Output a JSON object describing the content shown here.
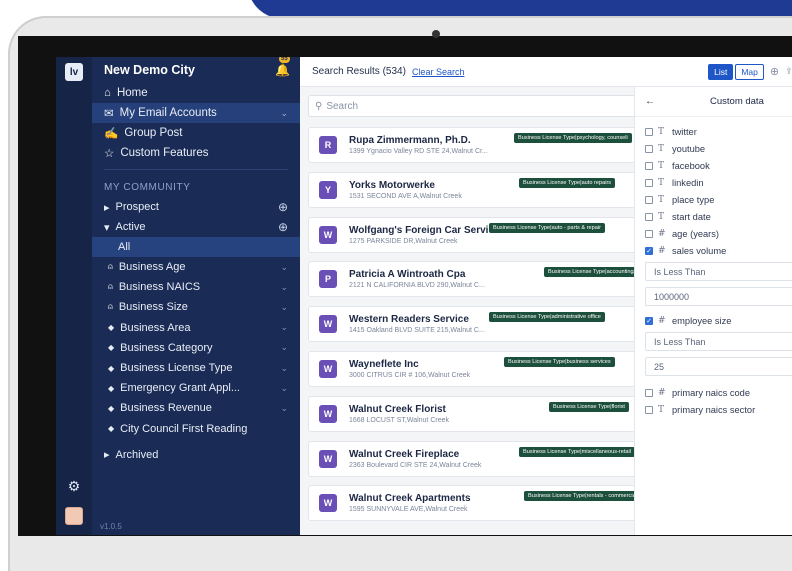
{
  "rail": {
    "logo": "lv"
  },
  "sidebar": {
    "title": "New Demo City",
    "notif_count": "55",
    "items": [
      {
        "label": "Home",
        "icon": "home-icon"
      },
      {
        "label": "My Email Accounts",
        "icon": "mail-icon",
        "chev": "⌄"
      },
      {
        "label": "Group Post",
        "icon": "group-icon"
      },
      {
        "label": "Custom Features",
        "icon": "star-icon"
      }
    ],
    "section_label": "MY COMMUNITY",
    "prospect": "Prospect",
    "active": "Active",
    "all": "All",
    "filters": [
      {
        "label": "Business Age",
        "icon": "lock"
      },
      {
        "label": "Business NAICS",
        "icon": "lock"
      },
      {
        "label": "Business Size",
        "icon": "lock"
      },
      {
        "label": "Business Area",
        "icon": "tag"
      },
      {
        "label": "Business Category",
        "icon": "tag"
      },
      {
        "label": "Business License Type",
        "icon": "tag"
      },
      {
        "label": "Emergency Grant Appl...",
        "icon": "tag"
      },
      {
        "label": "Business Revenue",
        "icon": "tag"
      },
      {
        "label": "City Council First Reading",
        "icon": "tag"
      }
    ],
    "archived": "Archived",
    "version": "v1.0.5"
  },
  "topbar": {
    "results": "Search Results (534)",
    "clear": "Clear Search",
    "list": "List",
    "map": "Map",
    "share": "Sc"
  },
  "search": {
    "placeholder": "Search"
  },
  "cards": [
    {
      "initial": "R",
      "name": "Rupa Zimmermann, Ph.D.",
      "addr": "1399 Ygnacio Valley RD STE 24,Walnut Cr...",
      "tag": "Business License Type|psychology, counseli"
    },
    {
      "initial": "Y",
      "name": "Yorks Motorwerke",
      "addr": "1531 SECOND AVE A,Walnut Creek",
      "tag": "Business License Type|auto repairs"
    },
    {
      "initial": "W",
      "name": "Wolfgang's Foreign Car Service",
      "addr": "1275 PARKSIDE DR,Walnut Creek",
      "tag": "Business License Type|auto - parts & repair"
    },
    {
      "initial": "P",
      "name": "Patricia A Wintroath Cpa",
      "addr": "2121 N CALIFORNIA BLVD 290,Walnut C...",
      "tag": "Business License Type|accounting/cp"
    },
    {
      "initial": "W",
      "name": "Western Readers Service",
      "addr": "1415 Oakland BLVD SUITE 215,Walnut C...",
      "tag": "Business License Type|administrative office"
    },
    {
      "initial": "W",
      "name": "Wayneflete Inc",
      "addr": "3000 CITRUS CIR # 106,Walnut Creek",
      "tag": "Business License Type|business services"
    },
    {
      "initial": "W",
      "name": "Walnut Creek Florist",
      "addr": "1668 LOCUST ST,Walnut Creek",
      "tag": "Business License Type|florist"
    },
    {
      "initial": "W",
      "name": "Walnut Creek Fireplace",
      "addr": "2363 Boulevard CIR STE 24,Walnut Creek",
      "tag": "Business License Type|miscellaneous-retail"
    },
    {
      "initial": "W",
      "name": "Walnut Creek Apartments",
      "addr": "1595 SUNNYVALE AVE,Walnut Creek",
      "tag": "Business License Type|rentals - commercia"
    }
  ],
  "panel": {
    "title": "Custom data",
    "fields": [
      {
        "type": "T",
        "label": "twitter",
        "checked": false
      },
      {
        "type": "T",
        "label": "youtube",
        "checked": false
      },
      {
        "type": "T",
        "label": "facebook",
        "checked": false
      },
      {
        "type": "T",
        "label": "linkedin",
        "checked": false
      },
      {
        "type": "T",
        "label": "place type",
        "checked": false
      },
      {
        "type": "T",
        "label": "start date",
        "checked": false
      },
      {
        "type": "#",
        "label": "age (years)",
        "checked": false
      },
      {
        "type": "#",
        "label": "sales volume",
        "checked": true
      }
    ],
    "sales_op": "Is Less Than",
    "sales_val": "1000000",
    "emp_label": "employee size",
    "emp_type": "#",
    "emp_op": "Is Less Than",
    "emp_val": "25",
    "more": [
      {
        "type": "#",
        "label": "primary naics code"
      },
      {
        "type": "T",
        "label": "primary naics sector"
      }
    ]
  }
}
